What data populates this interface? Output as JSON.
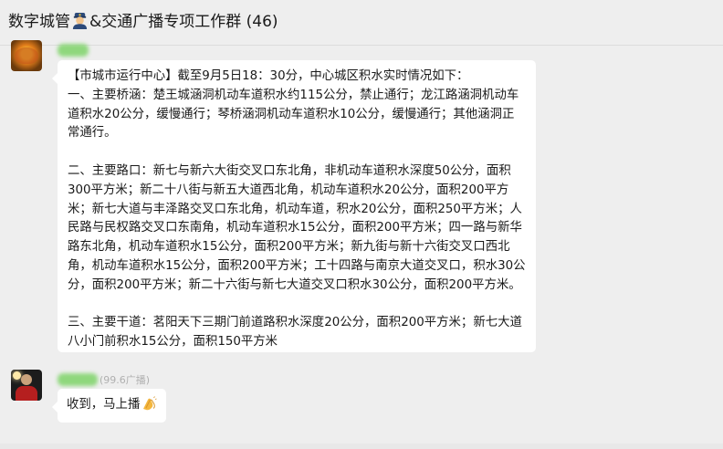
{
  "window": {
    "title_prefix": "数字城管",
    "title_suffix": "&交通广播专项工作群 (46)",
    "title_emoji": "police-officer-icon"
  },
  "messages": [
    {
      "sender_avatar": "autumn-leaves-avatar",
      "sender_name_suffix": "",
      "paragraphs": [
        "【市城市运行中心】截至9月5日18：30分，中心城区积水实时情况如下：",
        "一、主要桥涵：楚王城涵洞机动车道积水约115公分，禁止通行；龙江路涵洞机动车道积水20公分，缓慢通行；琴桥涵洞机动车道积水10公分，缓慢通行；其他涵洞正常通行。",
        "",
        "二、主要路口：新七与新六大街交叉口东北角，非机动车道积水深度50公分，面积300平方米；新二十八街与新五大道西北角，机动车道积水20公分，面积200平方米；新七大道与丰泽路交叉口东北角，机动车道，积水20公分，面积250平方米；人民路与民权路交叉口东南角，机动车道积水15公分，面积200平方米；四一路与新华路东北角，机动车道积水15公分，面积200平方米；新九街与新十六街交叉口西北角，机动车道积水15公分，面积200平方米；工十四路与南京大道交叉口，积水30公分，面积200平方米；新二十六街与新七大道交叉口积水30公分，面积200平方米。",
        "",
        "三、主要干道：茗阳天下三期门前道路积水深度20公分，面积200平方米；新七大道八小门前积水15公分，面积150平方米"
      ]
    },
    {
      "sender_avatar": "person-portrait-avatar",
      "sender_name_suffix": "(99.6广播)",
      "text": "收到，马上播",
      "emoji": "clapping-hands-icon"
    }
  ]
}
